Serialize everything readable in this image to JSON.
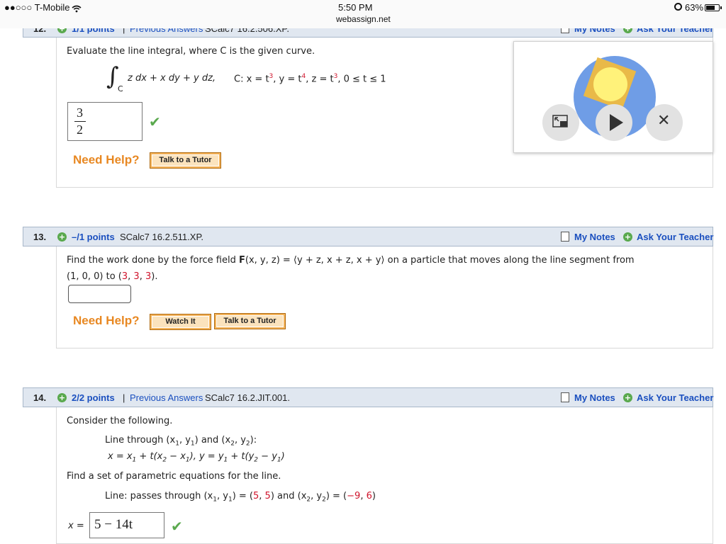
{
  "status_bar": {
    "carrier": "●●○○○ T-Mobile",
    "time": "5:50 PM",
    "site": "webassign.net",
    "battery_text": "63%",
    "battery_level": 0.63
  },
  "q12": {
    "number": "12.",
    "points": "1/1 points",
    "separator": "|",
    "previous_answers": "Previous Answers",
    "code": "SCalc7 16.2.506.XP.",
    "my_notes": "My Notes",
    "ask_teacher": "Ask Your Teacher",
    "prompt": "Evaluate the line integral, where C is the given curve.",
    "integral_sign": "∫",
    "integral_sub": "C",
    "integrand": "z dx + x dy + y dz,",
    "curve_label": "C: x = t",
    "exp_x": "3",
    "y_label": ",    y = t",
    "exp_y": "4",
    "z_label": ",    z = t",
    "exp_z": "3",
    "range": ",    0 ≤ t ≤ 1",
    "answer_num": "3",
    "answer_den": "2",
    "need_help": "Need Help?",
    "tutor_btn": "Talk to a Tutor"
  },
  "q13": {
    "number": "13.",
    "points": "–/1 points",
    "code": "SCalc7 16.2.511.XP.",
    "my_notes": "My Notes",
    "ask_teacher": "Ask Your Teacher",
    "p1": "Find the work done by the force field ",
    "p_F": "F",
    "p2": "(x, y, z) = ⟨y + z, x + z, x + y⟩  on a particle that moves along the line segment from",
    "l2a": "(1, 0, 0) to (",
    "l2b": "3",
    "l2c": ", ",
    "l2d": "3",
    "l2e": ", ",
    "l2f": "3",
    "l2g": ").",
    "answer_value": "",
    "need_help": "Need Help?",
    "watch_btn": "Watch It",
    "tutor_btn": "Talk to a Tutor"
  },
  "q14": {
    "number": "14.",
    "points": "2/2 points",
    "separator": "|",
    "previous_answers": "Previous Answers",
    "code": "SCalc7 16.2.JIT.001.",
    "my_notes": "My Notes",
    "ask_teacher": "Ask Your Teacher",
    "consider": "Consider the following.",
    "lt1": "Line through  (x",
    "s1": "1",
    "lt2": ", y",
    "s2": "1",
    "lt3": ") and (x",
    "s3": "2",
    "lt4": ", y",
    "s4": "2",
    "lt5": "):",
    "f1": "x = x",
    "fs1": "1",
    "f2": " + t(x",
    "fs2": "2",
    "f3": " − x",
    "fs3": "1",
    "f4": "), y = y",
    "fs4": "1",
    "f5": " + t(y",
    "fs5": "2",
    "f6": " − y",
    "fs6": "1",
    "f7": ")",
    "find": "Find a set of parametric equations for the line.",
    "pa": "Line: passes through  (x",
    "ps1": "1",
    "pb": ", y",
    "ps2": "1",
    "pc": ") = (",
    "pv1": "5",
    "pd": ", ",
    "pv2": "5",
    "pe": ")  and  (x",
    "ps3": "2",
    "pf": ", y",
    "ps4": "2",
    "pg": ") = (",
    "pv3": "−9",
    "ph": ", ",
    "pv4": "6",
    "pi": ")",
    "x_label": "x =",
    "x_answer": "5 − 14t"
  },
  "video": {
    "pip_icon": "picture-in-picture-icon",
    "play_icon": "play-icon",
    "close_icon": "close-icon",
    "close_glyph": "✕"
  },
  "colors": {
    "accent_red": "#d0142c",
    "link_blue": "#1a4fbf",
    "need_help_orange": "#e88822",
    "check_green": "#5aa94e"
  }
}
